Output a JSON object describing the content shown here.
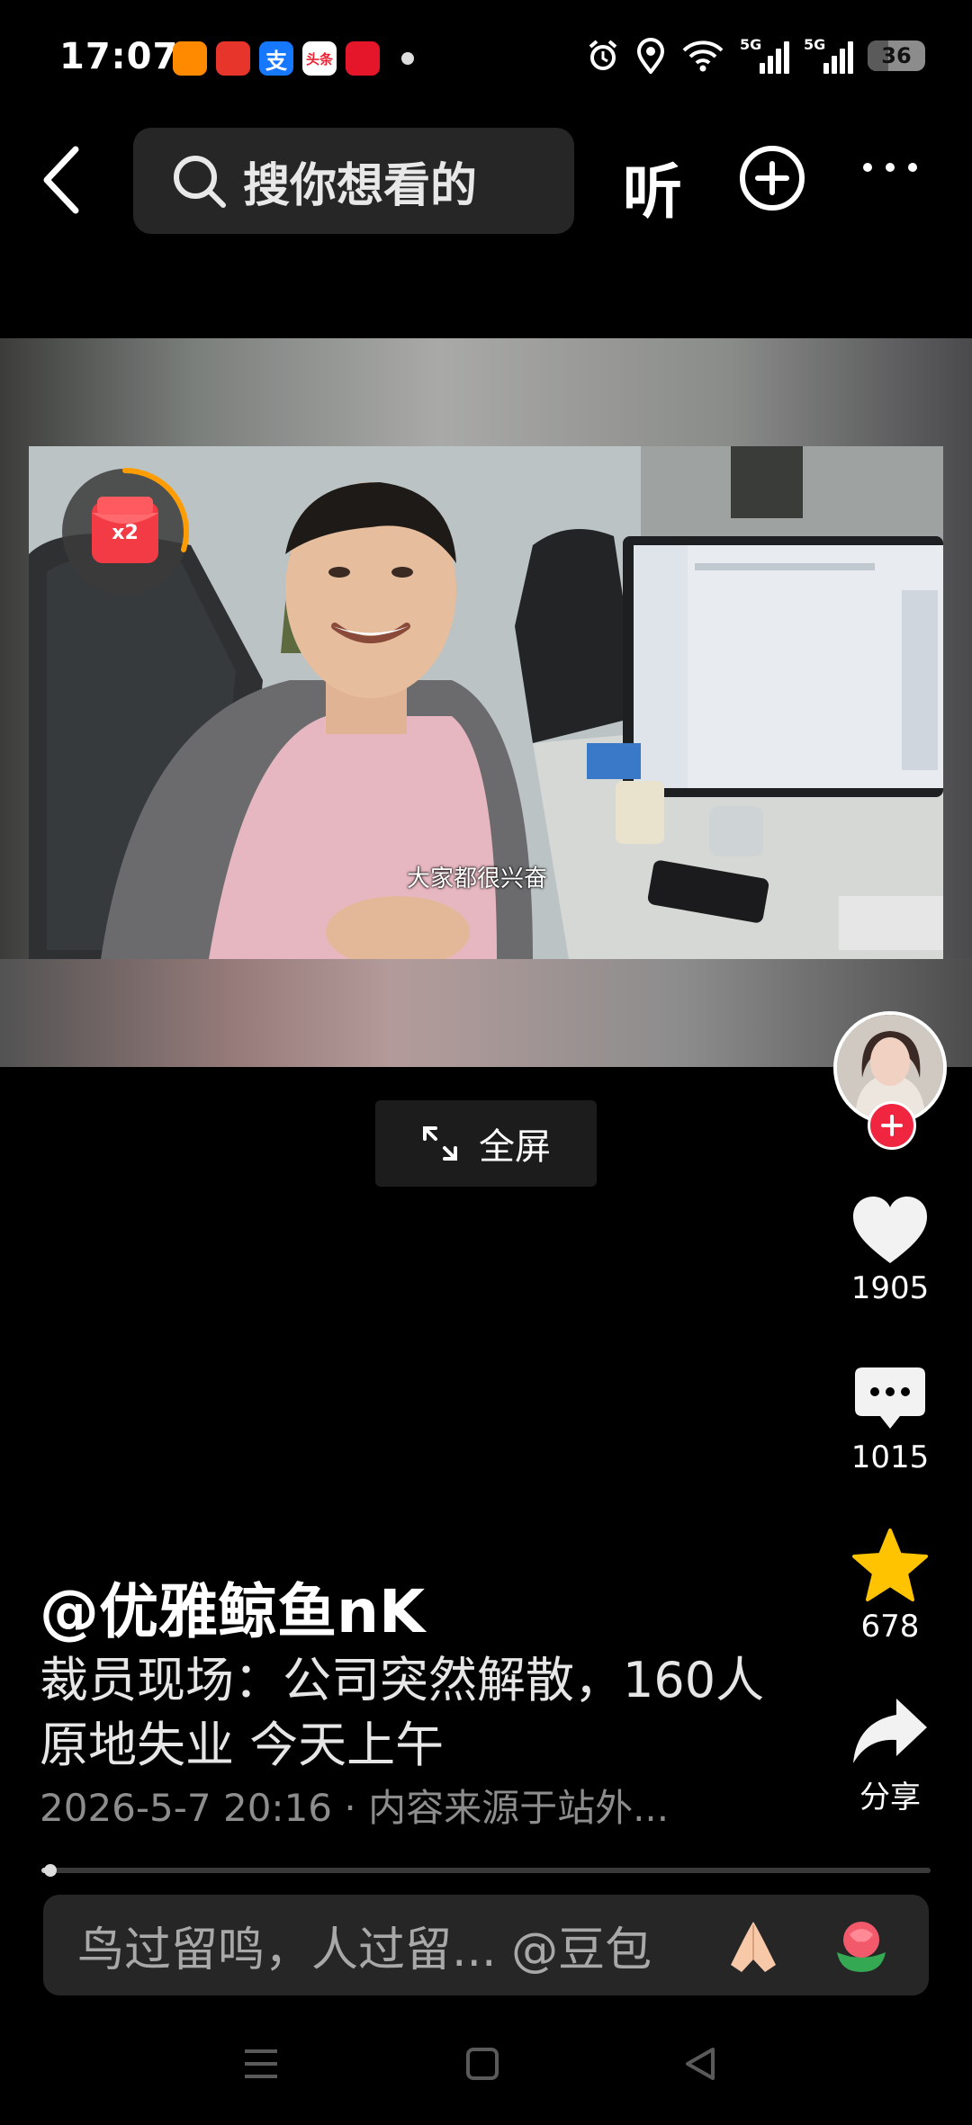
{
  "status_bar": {
    "time": "17:07",
    "app_badges": [
      "",
      "",
      "支",
      "头条",
      ""
    ],
    "network_1": "5G",
    "network_2": "5G",
    "battery": "36",
    "battery_level_percent": 36
  },
  "top_nav": {
    "search_placeholder": "搜你想看的",
    "listen_label": "听"
  },
  "video": {
    "subtitle": "大家都很兴奋",
    "redpacket_badge": "x2"
  },
  "fullscreen_label": "全屏",
  "rail": {
    "likes": "1905",
    "comments": "1015",
    "favorites": "678",
    "share_label": "分享"
  },
  "post": {
    "author": "@优雅鲸鱼nK",
    "description": "裁员现场：公司突然解散，160人原地失业 今天上午",
    "meta": "2026-5-7 20:16 · 内容来源于站外..."
  },
  "progress_fraction": 0.01,
  "comment_bar": {
    "text": "鸟过留鸣，人过留... @豆包"
  },
  "colors": {
    "background": "#000000",
    "accent_red": "#f0253f",
    "star_yellow": "#ffc300",
    "panel": "#262626"
  }
}
